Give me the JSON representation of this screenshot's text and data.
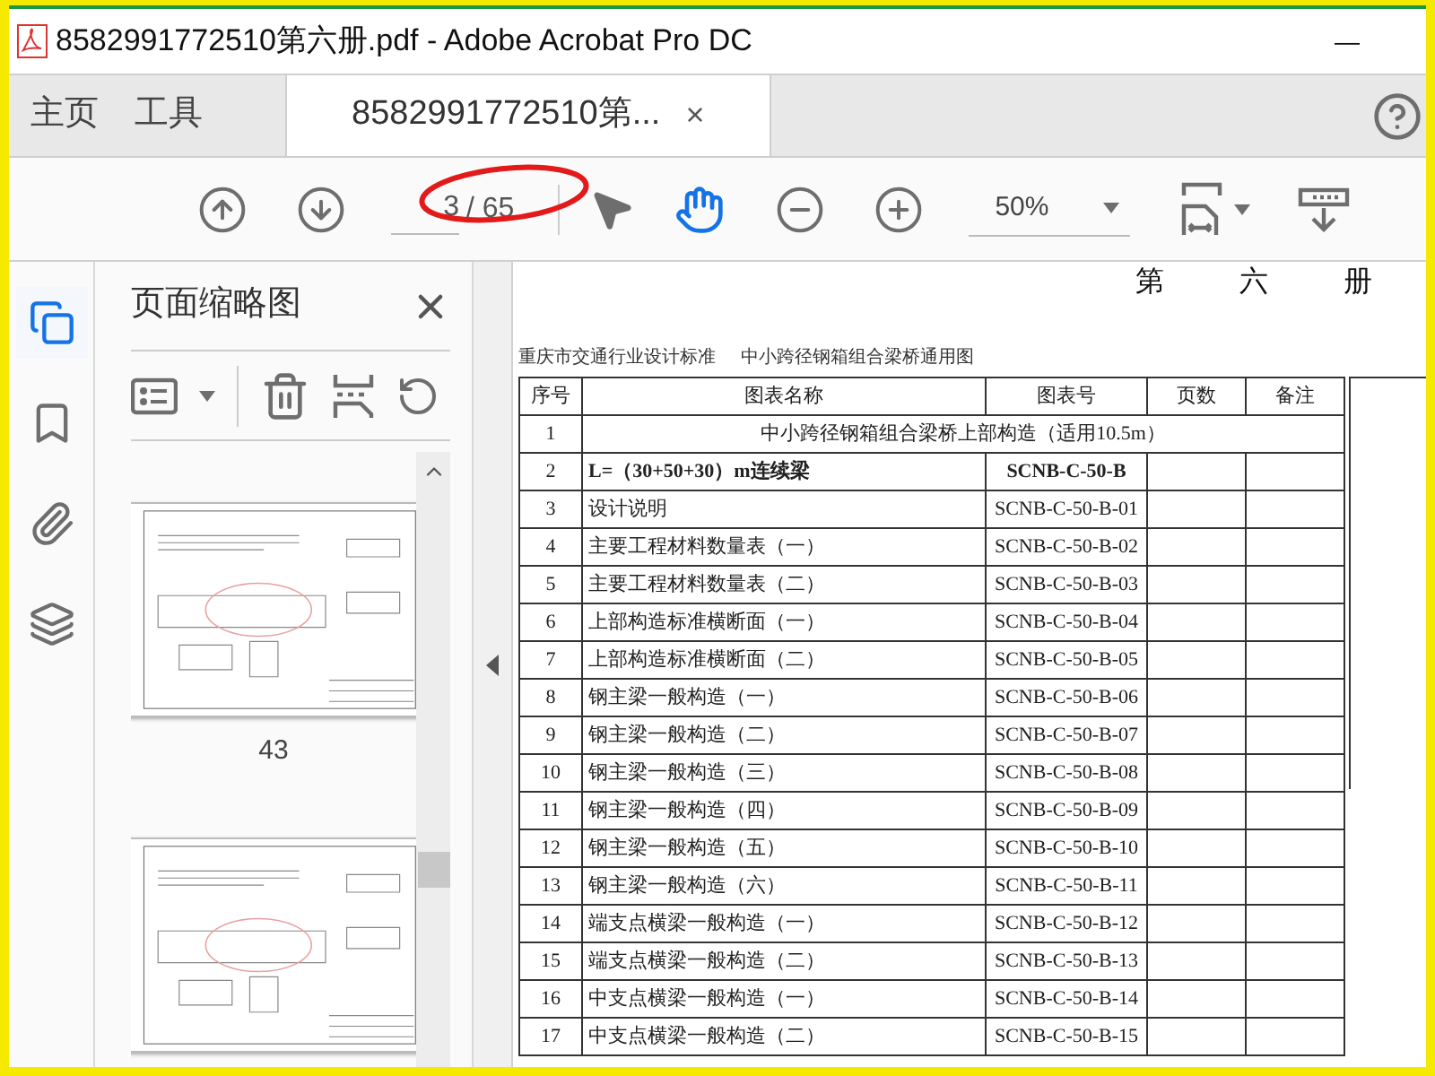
{
  "window": {
    "title": "8582991772510第六册.pdf - Adobe Acrobat Pro DC",
    "minimize": "—"
  },
  "tabs": [
    {
      "label": "主页",
      "selected": false
    },
    {
      "label": "工具",
      "selected": false
    },
    {
      "label": "8582991772510第...",
      "selected": true,
      "close": "×"
    }
  ],
  "toolbar": {
    "page": "3",
    "total": "/ 65",
    "zoom": "50%",
    "annotated": true,
    "hand_selected": true
  },
  "rail": [
    {
      "kind": "pages",
      "selected": true
    },
    {
      "kind": "bookmarks",
      "selected": false
    },
    {
      "kind": "attachments",
      "selected": false
    },
    {
      "kind": "layers",
      "selected": false
    }
  ],
  "thumbnails_panel": {
    "title": "页面缩略图",
    "thumbnail_labels": [
      "43"
    ]
  },
  "document": {
    "heading": [
      "第",
      "六",
      "册"
    ],
    "caption": [
      "重庆市交通行业设计标准",
      "中小跨径钢箱组合梁桥通用图"
    ],
    "columns": [
      "序号",
      "图表名称",
      "图表号",
      "页数",
      "备注"
    ],
    "rows": [
      {
        "kind": "section",
        "no": "1",
        "name": "中小跨径钢箱组合梁桥上部构造（适用10.5m）"
      },
      {
        "kind": "bold",
        "no": "2",
        "name": "L=（30+50+30）m连续梁",
        "code": "SCNB-C-50-B"
      },
      {
        "kind": "item",
        "no": "3",
        "name": "设计说明",
        "code": "SCNB-C-50-B-01"
      },
      {
        "kind": "item",
        "no": "4",
        "name": "主要工程材料数量表（一）",
        "code": "SCNB-C-50-B-02"
      },
      {
        "kind": "item",
        "no": "5",
        "name": "主要工程材料数量表（二）",
        "code": "SCNB-C-50-B-03"
      },
      {
        "kind": "item",
        "no": "6",
        "name": "上部构造标准横断面（一）",
        "code": "SCNB-C-50-B-04"
      },
      {
        "kind": "item",
        "no": "7",
        "name": "上部构造标准横断面（二）",
        "code": "SCNB-C-50-B-05"
      },
      {
        "kind": "item",
        "no": "8",
        "name": "钢主梁一般构造（一）",
        "code": "SCNB-C-50-B-06"
      },
      {
        "kind": "item",
        "no": "9",
        "name": "钢主梁一般构造（二）",
        "code": "SCNB-C-50-B-07"
      },
      {
        "kind": "item",
        "no": "10",
        "name": "钢主梁一般构造（三）",
        "code": "SCNB-C-50-B-08"
      },
      {
        "kind": "item",
        "no": "11",
        "name": "钢主梁一般构造（四）",
        "code": "SCNB-C-50-B-09"
      },
      {
        "kind": "item",
        "no": "12",
        "name": "钢主梁一般构造（五）",
        "code": "SCNB-C-50-B-10"
      },
      {
        "kind": "item",
        "no": "13",
        "name": "钢主梁一般构造（六）",
        "code": "SCNB-C-50-B-11"
      },
      {
        "kind": "item",
        "no": "14",
        "name": "端支点横梁一般构造（一）",
        "code": "SCNB-C-50-B-12"
      },
      {
        "kind": "item",
        "no": "15",
        "name": "端支点横梁一般构造（二）",
        "code": "SCNB-C-50-B-13"
      },
      {
        "kind": "item",
        "no": "16",
        "name": "中支点横梁一般构造（一）",
        "code": "SCNB-C-50-B-14"
      },
      {
        "kind": "item",
        "no": "17",
        "name": "中支点横梁一般构造（二）",
        "code": "SCNB-C-50-B-15"
      }
    ]
  }
}
